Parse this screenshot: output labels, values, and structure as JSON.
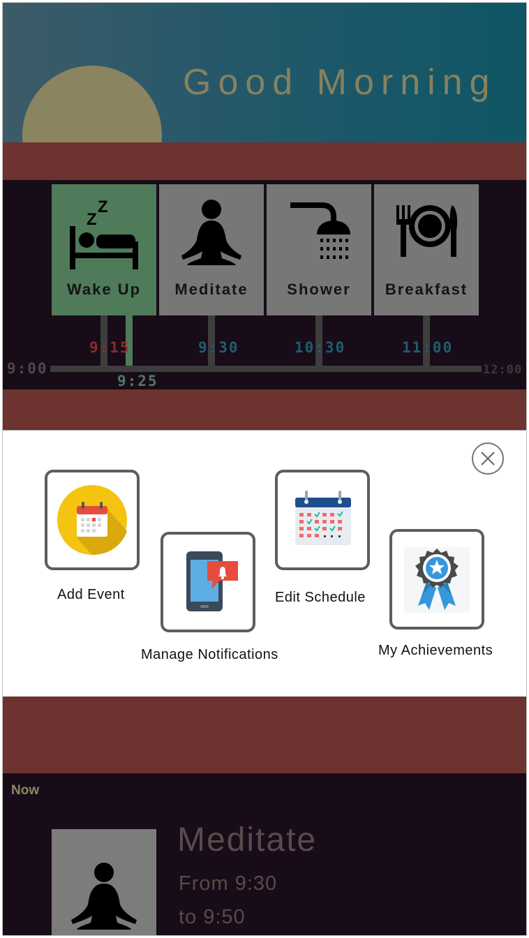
{
  "header": {
    "greeting": "Good Morning"
  },
  "timeline": {
    "activities": [
      {
        "label": "Wake Up",
        "icon": "bed-icon",
        "active": true
      },
      {
        "label": "Meditate",
        "icon": "meditation-icon",
        "active": false
      },
      {
        "label": "Shower",
        "icon": "shower-icon",
        "active": false
      },
      {
        "label": "Breakfast",
        "icon": "plate-cutlery-icon",
        "active": false
      }
    ],
    "axis_start": "9:00",
    "axis_end": "12:00",
    "times": [
      "9:15",
      "9:30",
      "10:30",
      "11:00"
    ],
    "current_time": "9:25",
    "colors": {
      "past": "#8a2b2c",
      "upcoming": "#1d5e71",
      "current": "#4f7b5b"
    }
  },
  "menu": {
    "close_icon": "close-icon",
    "items": [
      {
        "label": "Add Event",
        "icon": "calendar-add-icon"
      },
      {
        "label": "Manage Notifications",
        "icon": "phone-notification-icon"
      },
      {
        "label": "Edit Schedule",
        "icon": "calendar-schedule-icon"
      },
      {
        "label": "My Achievements",
        "icon": "award-ribbon-icon"
      }
    ]
  },
  "now": {
    "section_label": "Now",
    "title": "Meditate",
    "from": "From 9:30",
    "to": "to 9:50",
    "icon": "meditation-icon"
  },
  "colors": {
    "header_gradient": [
      "#3d5b68",
      "#0f5666"
    ],
    "maroon": "#6d3331",
    "dark": "#180c18",
    "sun": "#8a8461",
    "card_gray": "#777777",
    "card_active": "#4f7b5b"
  }
}
